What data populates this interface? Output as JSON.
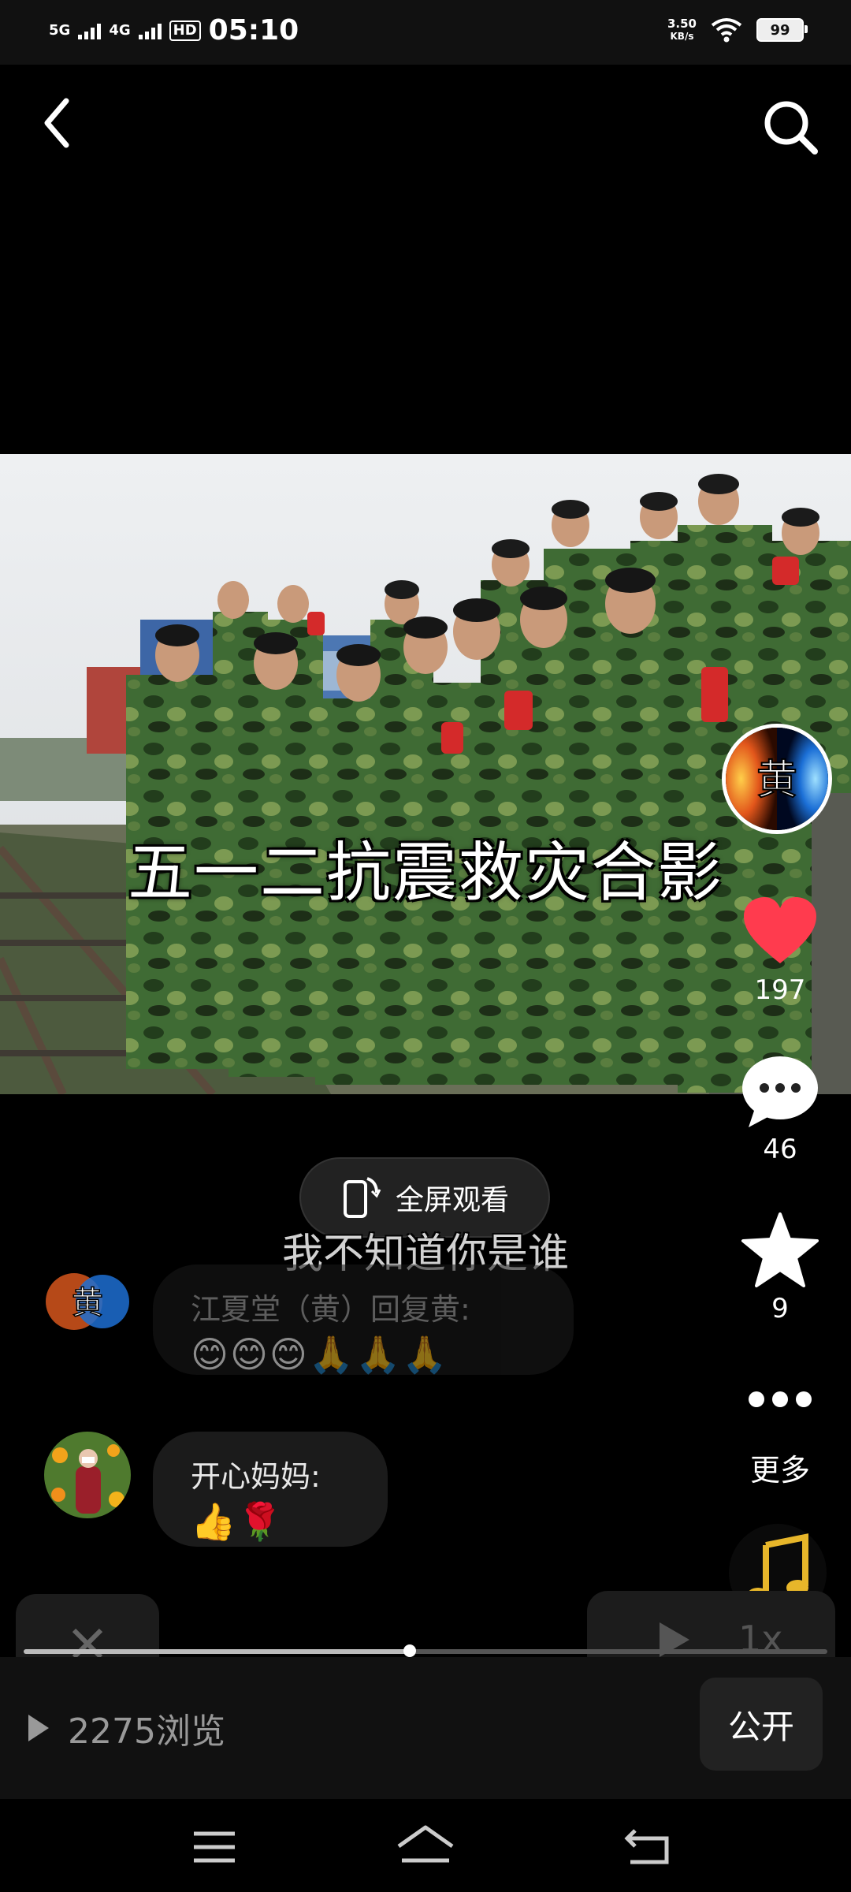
{
  "status_bar": {
    "network1": "5G",
    "network2": "4G",
    "hd": "HD",
    "time": "05:10",
    "speed_value": "3.50",
    "speed_unit": "KB/s",
    "battery": "99"
  },
  "photo": {
    "caption": "五一二抗震救灾合影"
  },
  "rail": {
    "author_avatar_char": "黄",
    "likes": "197",
    "comments": "46",
    "favorites": "9",
    "more_label": "更多"
  },
  "overlay": {
    "fullscreen_label": "全屏观看",
    "subtitle": "我不知道你是谁"
  },
  "comments": [
    {
      "name": "江夏堂（黄）回复黄:",
      "body": "😊😊😊🙏🙏🙏",
      "avatar_char": "黄"
    },
    {
      "name": "开心妈妈:",
      "body": "👍🌹"
    }
  ],
  "controls": {
    "speed": "1x",
    "progress": 0.48
  },
  "footer": {
    "views": "2275浏览",
    "public_label": "公开"
  },
  "colors": {
    "like": "#ff3b4e",
    "background": "#000000"
  }
}
